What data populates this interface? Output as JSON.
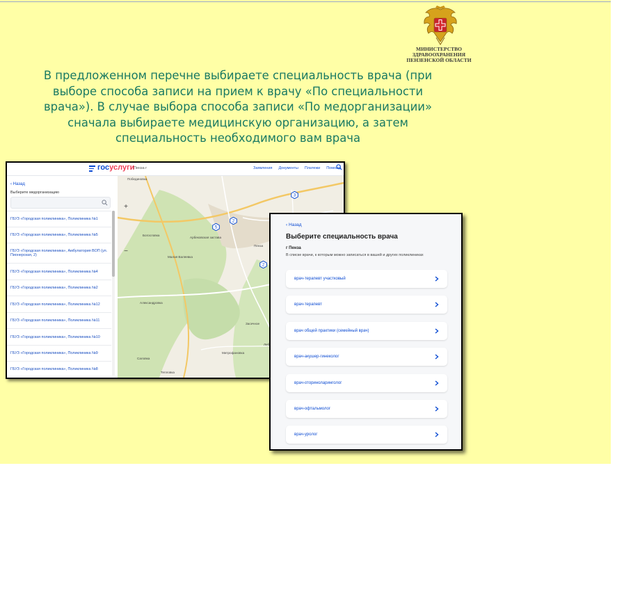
{
  "ministry": {
    "line1": "МИНИСТЕРСТВО",
    "line2": "ЗДРАВООХРАНЕНИЯ",
    "line3": "ПЕНЗЕНСКОЙ ОБЛАСТИ"
  },
  "instruction": {
    "line1": "В предложенном перечне выбираете специальность врача (при",
    "line2": "выборе способа записи на прием к врачу «По специальности",
    "line3": "врача»). В случае выбора способа записи «По медорганизации»",
    "line4": "сначала выбираете медицинскую организацию, а затем",
    "line5": "специальность необходимого вам врача"
  },
  "screen1": {
    "logo_gos": "гос",
    "logo_uslugi": "услуги",
    "city": "Пенза г",
    "nav": [
      "Заявления",
      "Документы",
      "Платежи",
      "Помощь"
    ],
    "back": "‹ Назад",
    "choose_label": "Выберите медорганизацию",
    "orgs": [
      "ГБУЗ «Городская поликлиника», Поликлиника №1",
      "ГБУЗ «Городская поликлиника», Поликлиника №5",
      "ГБУЗ «Городская поликлиника», Амбулатория ВОП (ул. Пионерская, 2)",
      "ГБУЗ «Городская поликлиника», Поликлиника №4",
      "ГБУЗ «Городская поликлиника», Поликлиника №2",
      "ГБУЗ «Городская поликлиника», Поликлиника №12",
      "ГБУЗ «Городская поликлиника», Поликлиника №11",
      "ГБУЗ «Городская поликлиника», Поликлиника №10",
      "ГБУЗ «Городская поликлиника», Поликлиника №9",
      "ГБУЗ «Городская поликлиника», Поликлиника №8"
    ],
    "map": {
      "labels": [
        "Побединовка",
        "Богословка",
        "Арбековская застава",
        "Малая Валяевка",
        "Александровка",
        "Засечное",
        "Саловка",
        "Митрофановка",
        "Тепловка",
        "Лебедевка",
        "Пенза"
      ],
      "clusters": [
        "5",
        "2",
        "3",
        "2"
      ]
    }
  },
  "screen2": {
    "back": "‹ Назад",
    "title": "Выберите специальность врача",
    "city": "г Пенза",
    "note": "В списке врачи, к которым можно записаться в вашей и других поликлиниках",
    "specialties": [
      "врач-терапевт участковый",
      "врач-терапевт",
      "врач общей практики (семейный врач)",
      "врач-акушер-гинеколог",
      "врач-оториноларинголог",
      "врач-офтальмолог",
      "врач-уролог"
    ]
  },
  "colors": {
    "slide_bg": "#ffffa6",
    "instruction_text": "#1a7a63",
    "gosuslugi_blue": "#0d4cd3",
    "gosuslugi_red": "#ee3f58"
  }
}
